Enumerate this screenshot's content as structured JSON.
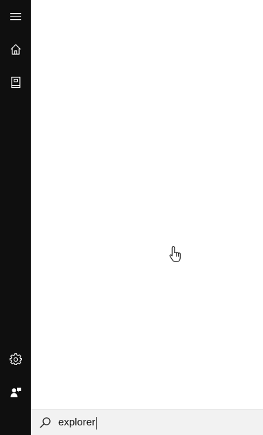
{
  "sidebar": {
    "items": [
      {
        "name": "menu",
        "icon": "hamburger-menu-icon"
      },
      {
        "name": "home",
        "icon": "home-icon"
      },
      {
        "name": "notebook",
        "icon": "notebook-icon"
      },
      {
        "name": "settings",
        "icon": "gear-icon"
      },
      {
        "name": "feedback",
        "icon": "feedback-icon"
      }
    ],
    "background": "#0f0f0f",
    "icon_color": "#ffffff"
  },
  "search": {
    "value": "explorer",
    "icon": "search-icon",
    "background": "#f2f2f2"
  },
  "pointer": {
    "icon": "hand-pointer-icon"
  }
}
